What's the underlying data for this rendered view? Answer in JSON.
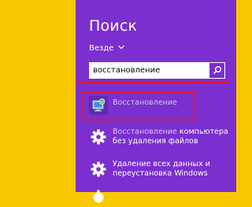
{
  "charm": {
    "title": "Поиск",
    "scope": "Везде",
    "search": {
      "value": "восстановление"
    }
  },
  "results": [
    {
      "highlight": "Восстановление",
      "rest1": "",
      "line2": ""
    },
    {
      "highlight": "Восстановление",
      "rest1": " компьютера",
      "line2": "без удаления файлов"
    },
    {
      "highlight": "",
      "rest1": "Удаление всех данных и",
      "line2": "переустановка Windows"
    }
  ],
  "colors": {
    "panel": "#7b2fce",
    "desktop": "#f9c900",
    "annotation": "#e3152f"
  }
}
